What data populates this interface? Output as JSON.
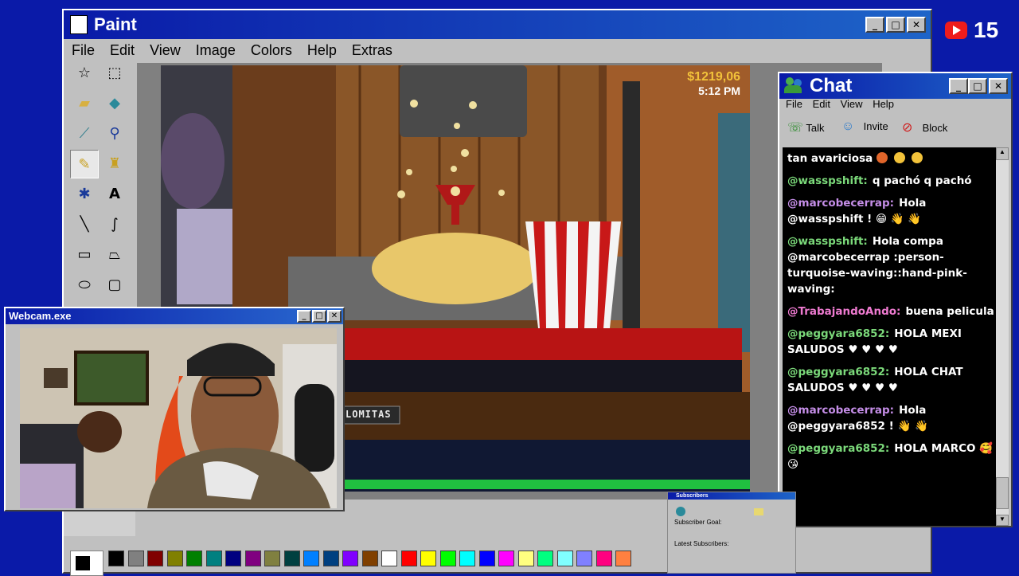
{
  "paint": {
    "title": "Paint",
    "menu": [
      "File",
      "Edit",
      "View",
      "Image",
      "Colors",
      "Help",
      "Extras"
    ],
    "tools": [
      "free-select",
      "rect-select",
      "eraser",
      "fill",
      "picker",
      "magnifier",
      "pencil",
      "brush",
      "airbrush",
      "text",
      "line",
      "curve",
      "rectangle",
      "polygon",
      "ellipse",
      "rounded-rect"
    ],
    "palette": [
      "#000000",
      "#808080",
      "#800000",
      "#808000",
      "#008000",
      "#008080",
      "#000080",
      "#800080",
      "#808040",
      "#004040",
      "#0080ff",
      "#004080",
      "#8000ff",
      "#804000",
      "#ffffff",
      "#ff0000",
      "#ffff00",
      "#00ff00",
      "#00ffff",
      "#0000ff",
      "#ff00ff",
      "#ffff80",
      "#00ff80",
      "#80ffff",
      "#8080ff",
      "#ff0080",
      "#ff8040"
    ]
  },
  "game": {
    "money": "$1219,06",
    "time": "5:12 PM",
    "machine_label": "LOMITAS"
  },
  "webcam": {
    "title": "Webcam.exe"
  },
  "chat": {
    "title": "Chat",
    "menu": [
      "File",
      "Edit",
      "View",
      "Help"
    ],
    "actions": [
      "Talk",
      "Invite",
      "Block"
    ],
    "messages": [
      {
        "user": "",
        "color": "#ffffff",
        "text": "tan avariciosa",
        "emotes": [
          "#e0652a",
          "#f2c23a",
          "#f2c23a"
        ]
      },
      {
        "user": "@wasspshift:",
        "color": "#7bd97a",
        "text": "q pachó q pachó",
        "emotes": []
      },
      {
        "user": "@marcobecerrap:",
        "color": "#c58ee8",
        "text": "Hola @wasspshift ! 😁 👋 👋",
        "emotes": []
      },
      {
        "user": "@wasspshift:",
        "color": "#7bd97a",
        "text": "Hola compa @marcobecerrap :person-turquoise-waving::hand-pink-waving:",
        "emotes": []
      },
      {
        "user": "@TrabajandoAndo:",
        "color": "#ee7ad0",
        "text": "buena pelicula",
        "emotes": []
      },
      {
        "user": "@peggyara6852:",
        "color": "#7bd97a",
        "text": "HOLA MEXI SALUDOS ♥ ♥ ♥ ♥",
        "emotes": []
      },
      {
        "user": "@peggyara6852:",
        "color": "#7bd97a",
        "text": "HOLA CHAT SALUDOS ♥ ♥ ♥ ♥",
        "emotes": []
      },
      {
        "user": "@marcobecerrap:",
        "color": "#c58ee8",
        "text": "Hola @peggyara6852 ! 👋 👋",
        "emotes": []
      },
      {
        "user": "@peggyara6852:",
        "color": "#7bd97a",
        "text": "HOLA MARCO 🥰 😘",
        "emotes": []
      }
    ]
  },
  "subscribers": {
    "title": "Subscribers",
    "goal_label": "Subscriber Goal:",
    "latest_label": "Latest Subscribers:"
  },
  "badge": {
    "count": "15"
  }
}
